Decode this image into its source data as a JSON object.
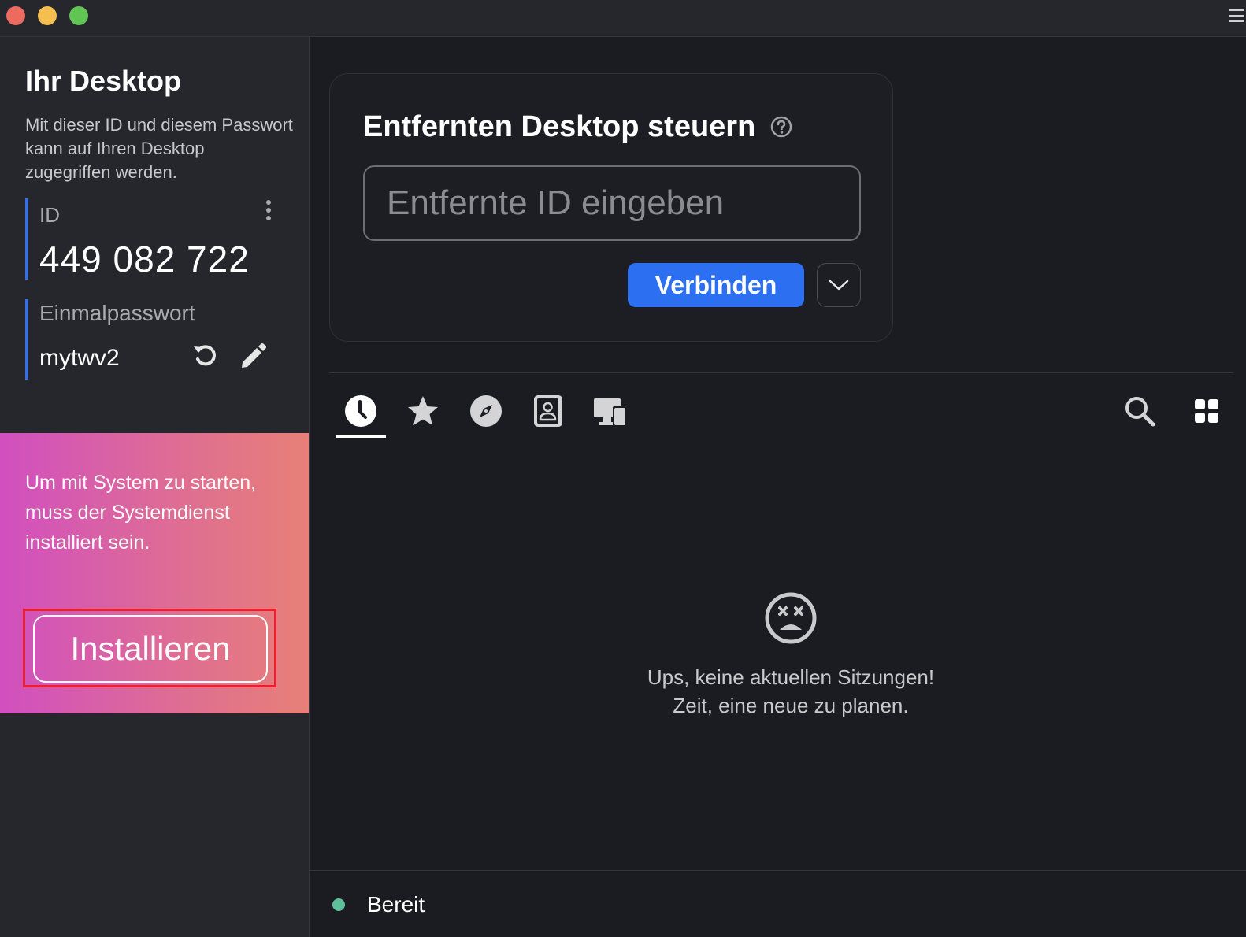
{
  "sidebar": {
    "title": "Ihr Desktop",
    "description": "Mit dieser ID und diesem Passwort kann auf Ihren Desktop zugegriffen werden.",
    "id_label": "ID",
    "id_value": "449 082 722",
    "password_label": "Einmalpasswort",
    "password_value": "mytwv2"
  },
  "promo": {
    "text": "Um mit System zu starten, muss der Systemdienst installiert sein.",
    "install_label": "Installieren"
  },
  "connect": {
    "title": "Entfernten Desktop steuern",
    "input_value": "",
    "input_placeholder": "Entfernte ID eingeben",
    "button_label": "Verbinden"
  },
  "tabs": [
    {
      "icon": "clock-icon",
      "active": true
    },
    {
      "icon": "star-icon",
      "active": false
    },
    {
      "icon": "compass-icon",
      "active": false
    },
    {
      "icon": "address-book-icon",
      "active": false
    },
    {
      "icon": "devices-icon",
      "active": false
    }
  ],
  "empty_state": {
    "line1": "Ups, keine aktuellen Sitzungen!",
    "line2": "Zeit, eine neue zu planen."
  },
  "status": {
    "text": "Bereit",
    "color": "#5fbf9a"
  },
  "colors": {
    "accent": "#2c6ff0",
    "highlight_box": "#e8202f"
  }
}
